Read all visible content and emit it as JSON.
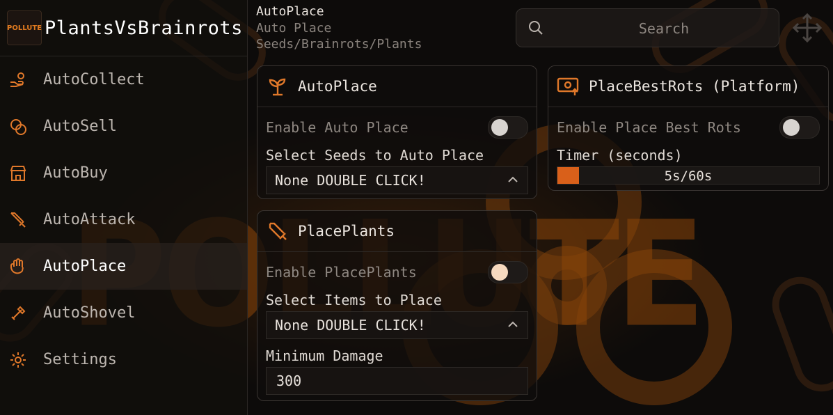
{
  "brand": {
    "title": "PlantsVsBrainrots",
    "logo_text": "POLLUTE"
  },
  "background": {
    "wordmark": "POLLUTE"
  },
  "sidebar": {
    "items": [
      {
        "label": "AutoCollect",
        "icon": "hand-coins-icon",
        "active": false
      },
      {
        "label": "AutoSell",
        "icon": "coins-icon",
        "active": false
      },
      {
        "label": "AutoBuy",
        "icon": "store-icon",
        "active": false
      },
      {
        "label": "AutoAttack",
        "icon": "sword-icon",
        "active": false
      },
      {
        "label": "AutoPlace",
        "icon": "hand-icon",
        "active": true
      },
      {
        "label": "AutoShovel",
        "icon": "shovel-icon",
        "active": false
      },
      {
        "label": "Settings",
        "icon": "gear-icon",
        "active": false
      }
    ]
  },
  "header": {
    "title": "AutoPlace",
    "subtitle_1": "Auto Place",
    "subtitle_2": "Seeds/Brainrots/Plants",
    "search_placeholder": "Search"
  },
  "cards": {
    "autoplace": {
      "title": "AutoPlace",
      "icon": "sprout-icon",
      "toggle_label": "Enable Auto Place",
      "toggle_on": false,
      "select_label": "Select Seeds to Auto Place",
      "select_value": "None DOUBLE CLICK!"
    },
    "placeplants": {
      "title": "PlacePlants",
      "icon": "sword-icon",
      "toggle_label": "Enable PlacePlants",
      "toggle_on": false,
      "select_label": "Select Items to Place",
      "select_value": "None DOUBLE CLICK!",
      "damage_label": "Minimum Damage",
      "damage_value": "300"
    },
    "placebest": {
      "title": "PlaceBestRots (Platform)",
      "icon": "money-upload-icon",
      "toggle_label": "Enable Place Best Rots",
      "toggle_on": false,
      "timer_label": "Timer (seconds)",
      "timer_text": "5s/60s",
      "timer_value": 5,
      "timer_max": 60
    }
  },
  "colors": {
    "accent": "#e0782a",
    "slider_fill": "#d9601a",
    "text": "#d9d4cf",
    "muted": "#8e8781"
  }
}
